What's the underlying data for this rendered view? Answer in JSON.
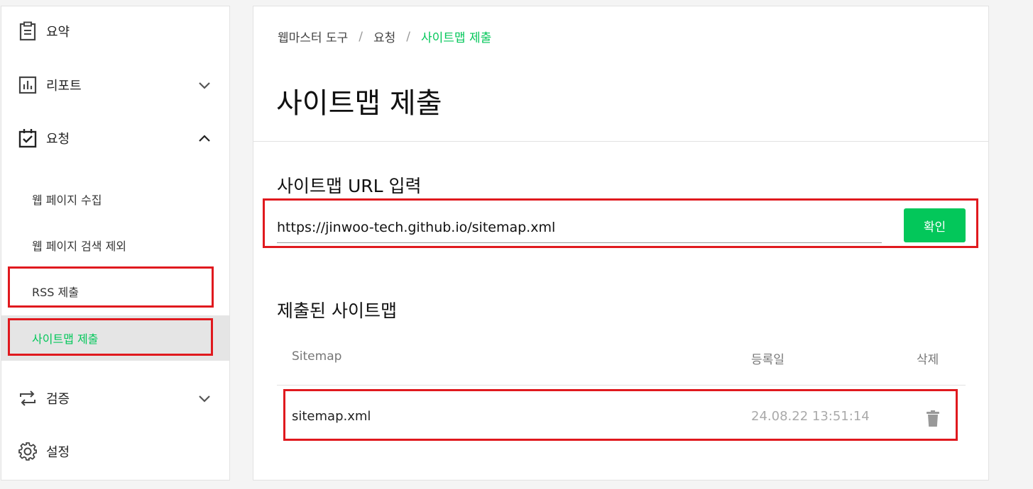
{
  "sidebar": {
    "items": [
      {
        "label": "요약",
        "icon": "clipboard-icon"
      },
      {
        "label": "리포트",
        "icon": "bar-chart-icon",
        "chevron": "chevron-down-icon"
      },
      {
        "label": "요청",
        "icon": "clipboard-check-icon",
        "chevron": "chevron-up-icon"
      },
      {
        "label": "검증",
        "icon": "repeat-arrows-icon",
        "chevron": "chevron-down-icon"
      },
      {
        "label": "설정",
        "icon": "gear-icon"
      }
    ],
    "subitems": [
      {
        "label": "웹 페이지 수집"
      },
      {
        "label": "웹 페이지 검색 제외"
      },
      {
        "label": "RSS 제출"
      },
      {
        "label": "사이트맵 제출"
      }
    ]
  },
  "breadcrumb": [
    "웹마스터 도구",
    "요청",
    "사이트맵 제출"
  ],
  "page_title": "사이트맵 제출",
  "url_section": {
    "title": "사이트맵 URL 입력",
    "value": "https://jinwoo-tech.github.io/sitemap.xml",
    "button": "확인"
  },
  "submitted": {
    "title": "제출된 사이트맵",
    "columns": [
      "Sitemap",
      "등록일",
      "삭제"
    ],
    "rows": [
      {
        "sitemap": "sitemap.xml",
        "date": "24.08.22 13:51:14",
        "delete_icon": "trash-icon"
      }
    ]
  },
  "colors": {
    "accent": "#03c75a",
    "annotation": "#e0191e"
  }
}
